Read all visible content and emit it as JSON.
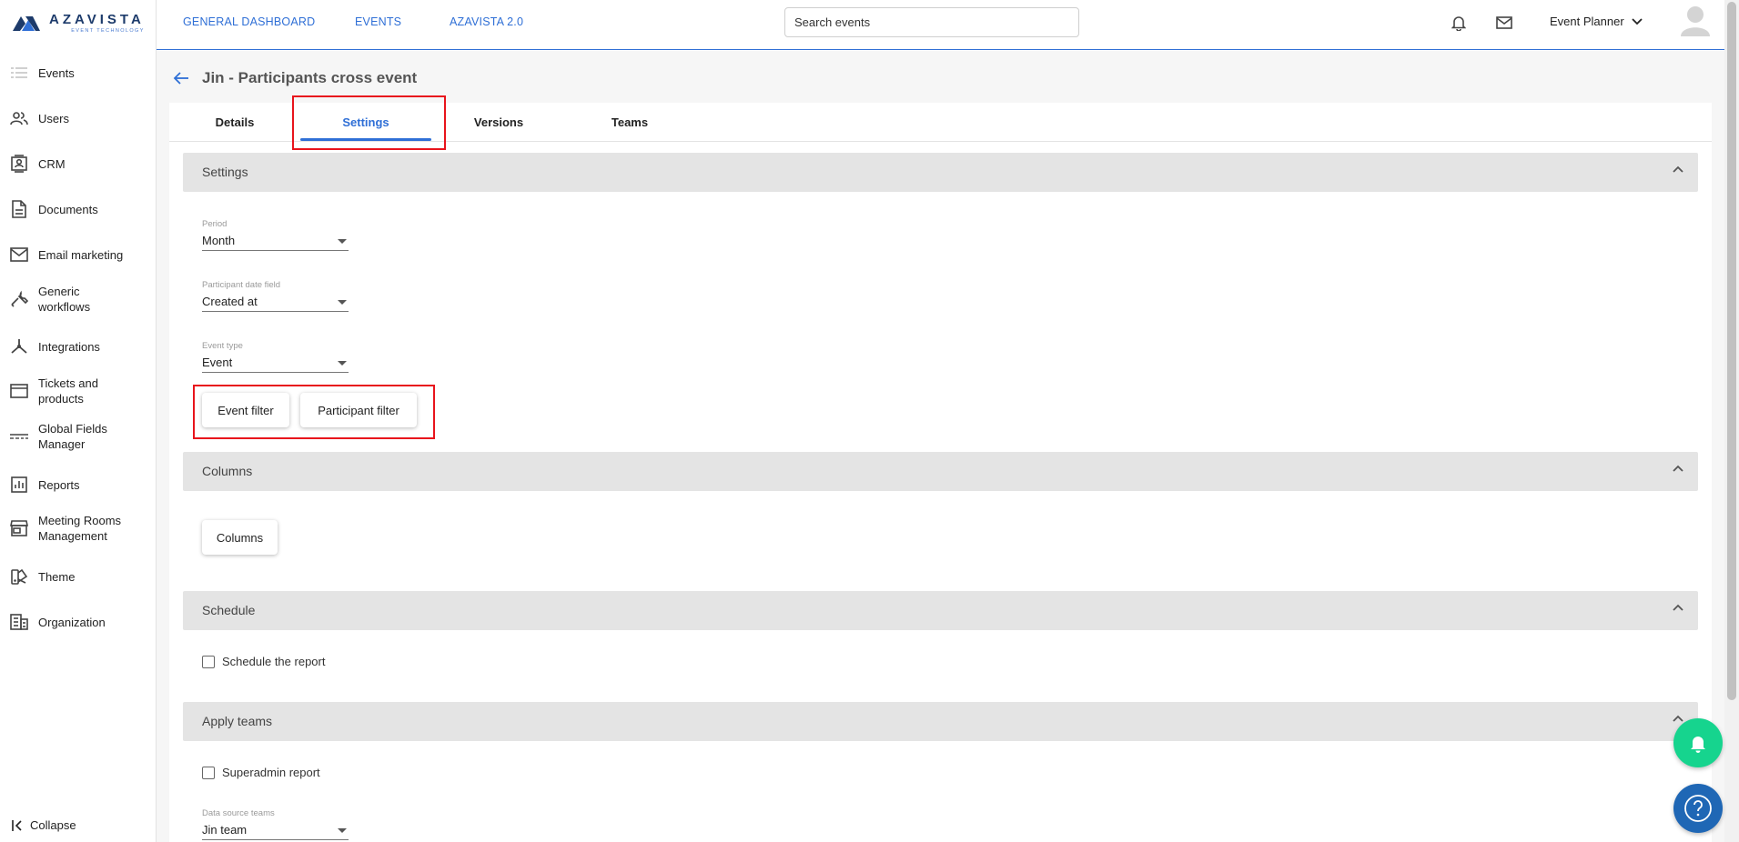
{
  "app": {
    "logo_name": "AZAVISTA",
    "logo_tagline": "EVENT TECHNOLOGY"
  },
  "colors": {
    "accent": "#2f6fd6",
    "highlight": "#e8141c",
    "fab_green": "#16d48e",
    "fab_blue": "#1f67b5"
  },
  "sidebar": {
    "items": [
      {
        "label": "Events",
        "icon": "list-icon"
      },
      {
        "label": "Users",
        "icon": "users-icon"
      },
      {
        "label": "CRM",
        "icon": "contact-card-icon"
      },
      {
        "label": "Documents",
        "icon": "document-icon"
      },
      {
        "label": "Email marketing",
        "icon": "mail-icon"
      },
      {
        "label": "Generic workflows",
        "icon": "wrench-icon"
      },
      {
        "label": "Integrations",
        "icon": "integrations-icon"
      },
      {
        "label": "Tickets and products",
        "icon": "card-icon"
      },
      {
        "label": "Global Fields Manager",
        "icon": "fields-icon"
      },
      {
        "label": "Reports",
        "icon": "report-icon"
      },
      {
        "label": "Meeting Rooms Management",
        "icon": "store-icon"
      },
      {
        "label": "Theme",
        "icon": "palette-icon"
      },
      {
        "label": "Organization",
        "icon": "building-icon"
      }
    ],
    "collapse_label": "Collapse"
  },
  "topbar": {
    "links": [
      "GENERAL DASHBOARD",
      "EVENTS",
      "AZAVISTA 2.0"
    ],
    "search_placeholder": "Search events",
    "user_label": "Event Planner"
  },
  "page": {
    "title": "Jin - Participants cross event",
    "tabs": [
      "Details",
      "Settings",
      "Versions",
      "Teams"
    ],
    "active_tab": "Settings"
  },
  "settings": {
    "header": "Settings",
    "period": {
      "label": "Period",
      "value": "Month"
    },
    "participant_date_field": {
      "label": "Participant date field",
      "value": "Created at"
    },
    "event_type": {
      "label": "Event type",
      "value": "Event"
    },
    "event_filter_label": "Event filter",
    "participant_filter_label": "Participant filter"
  },
  "columns": {
    "header": "Columns",
    "button_label": "Columns"
  },
  "schedule": {
    "header": "Schedule",
    "checkbox_label": "Schedule the report",
    "checked": false
  },
  "apply_teams": {
    "header": "Apply teams",
    "checkbox_label": "Superadmin report",
    "checked": false,
    "data_source": {
      "label": "Data source teams",
      "value": "Jin team"
    }
  }
}
